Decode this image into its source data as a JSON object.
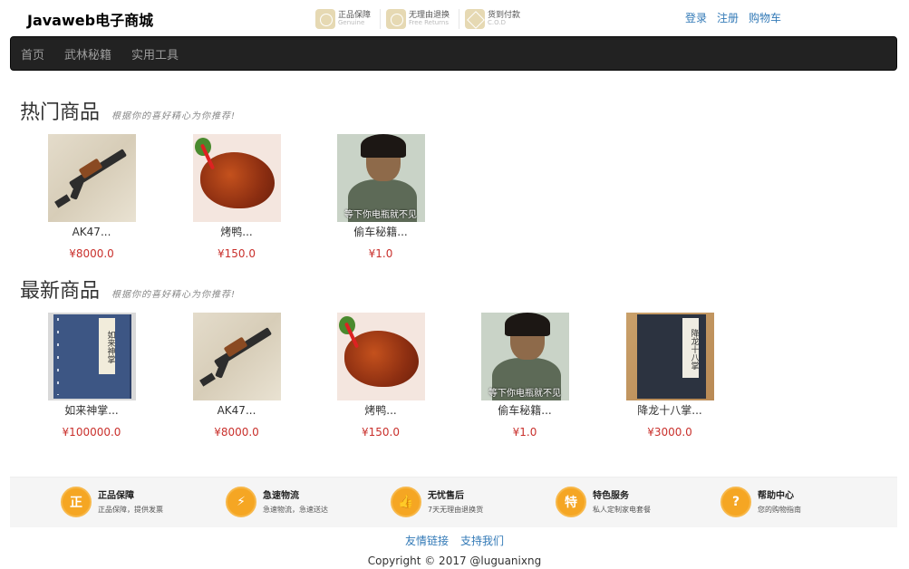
{
  "header": {
    "brand": "Javaweb电子商城",
    "badges": [
      {
        "title": "正品保障",
        "sub": "Genuine",
        "icon": "shield-icon"
      },
      {
        "title": "无理由退换",
        "sub": "Free Returns",
        "icon": "return-icon"
      },
      {
        "title": "货到付款",
        "sub": "C.O.D",
        "icon": "cod-icon"
      }
    ],
    "user_links": [
      "登录",
      "注册",
      "购物车"
    ]
  },
  "nav": {
    "items": [
      "首页",
      "武林秘籍",
      "实用工具"
    ]
  },
  "hot": {
    "title": "热门商品",
    "slogan": "根据你的喜好精心为你推荐!",
    "products": [
      {
        "name": "AK47...",
        "price": "¥8000.0",
        "image": "ak47-photo"
      },
      {
        "name": "烤鸭...",
        "price": "¥150.0",
        "image": "roast-duck-photo"
      },
      {
        "name": "偷车秘籍...",
        "price": "¥1.0",
        "image": "man-photo",
        "caption": "等下你电瓶就不见"
      }
    ]
  },
  "latest": {
    "title": "最新商品",
    "slogan": "根据你的喜好精心为你推荐!",
    "products": [
      {
        "name": "如来神掌...",
        "price": "¥100000.0",
        "image": "book-rulai-photo",
        "book_label": "如来神掌"
      },
      {
        "name": "AK47...",
        "price": "¥8000.0",
        "image": "ak47-photo"
      },
      {
        "name": "烤鸭...",
        "price": "¥150.0",
        "image": "roast-duck-photo"
      },
      {
        "name": "偷车秘籍...",
        "price": "¥1.0",
        "image": "man-photo",
        "caption": "等下你电瓶就不见"
      },
      {
        "name": "降龙十八掌...",
        "price": "¥3000.0",
        "image": "book-xianglong-photo",
        "book_label": "降龙十八掌"
      }
    ]
  },
  "services": [
    {
      "title": "正品保障",
      "desc": "正品保障，提供发票",
      "glyph": "正"
    },
    {
      "title": "急速物流",
      "desc": "急速物流，急速送达",
      "glyph": "⚡"
    },
    {
      "title": "无忧售后",
      "desc": "7天无理由退换货",
      "glyph": "👍"
    },
    {
      "title": "特色服务",
      "desc": "私人定制家电套餐",
      "glyph": "特"
    },
    {
      "title": "帮助中心",
      "desc": "您的购物指南",
      "glyph": "?"
    }
  ],
  "footer": {
    "links": [
      "友情链接",
      "支持我们"
    ],
    "copyright": "Copyright © 2017 @luguanixng"
  },
  "colors": {
    "navbar_bg": "#222222",
    "link": "#337ab7",
    "price": "#c9302c",
    "service_icon": "#f5a623"
  }
}
